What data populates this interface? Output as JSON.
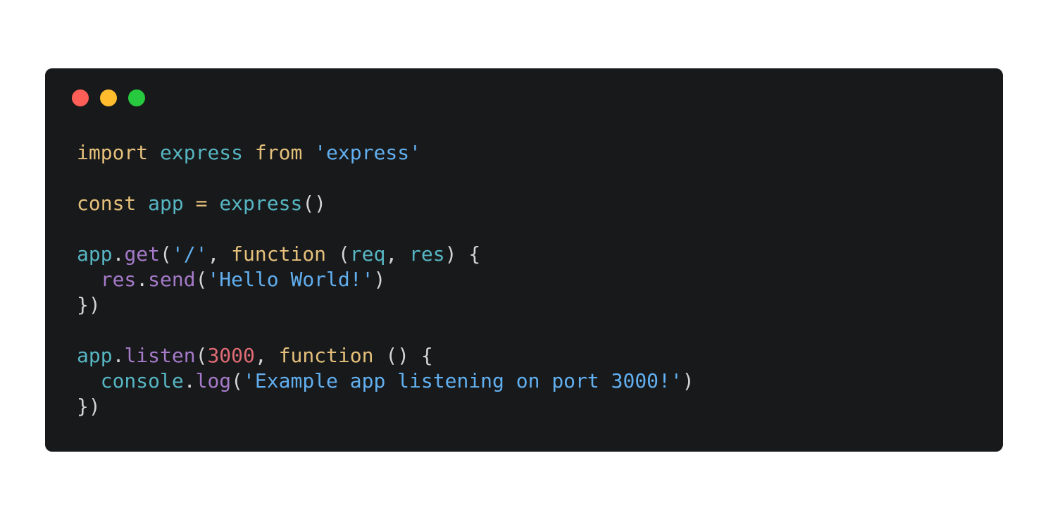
{
  "colors": {
    "page_bg": "#ffffff",
    "window_bg": "#18191b",
    "close": "#ff5f56",
    "minimize": "#ffbd2e",
    "maximize": "#27c93f",
    "keyword": "#e5c07b",
    "identifier": "#56b6c2",
    "method": "#a57ac9",
    "string": "#61afef",
    "number": "#e06c75",
    "punct": "#d4d4d4"
  },
  "window_controls": {
    "close_icon": "red-circle",
    "minimize_icon": "yellow-circle",
    "maximize_icon": "green-circle"
  },
  "code_lines": [
    [
      {
        "text": "import",
        "kind": "keyword"
      },
      {
        "text": " ",
        "kind": "punct"
      },
      {
        "text": "express",
        "kind": "identifier"
      },
      {
        "text": " ",
        "kind": "punct"
      },
      {
        "text": "from",
        "kind": "keyword"
      },
      {
        "text": " ",
        "kind": "punct"
      },
      {
        "text": "'express'",
        "kind": "string"
      }
    ],
    [],
    [
      {
        "text": "const",
        "kind": "keyword"
      },
      {
        "text": " ",
        "kind": "punct"
      },
      {
        "text": "app",
        "kind": "identifier"
      },
      {
        "text": " ",
        "kind": "punct"
      },
      {
        "text": "=",
        "kind": "keyword"
      },
      {
        "text": " ",
        "kind": "punct"
      },
      {
        "text": "express",
        "kind": "identifier"
      },
      {
        "text": "()",
        "kind": "punct"
      }
    ],
    [],
    [
      {
        "text": "app",
        "kind": "identifier"
      },
      {
        "text": ".",
        "kind": "punct"
      },
      {
        "text": "get",
        "kind": "method"
      },
      {
        "text": "(",
        "kind": "punct"
      },
      {
        "text": "'/'",
        "kind": "string"
      },
      {
        "text": ", ",
        "kind": "punct"
      },
      {
        "text": "function",
        "kind": "keyword"
      },
      {
        "text": " (",
        "kind": "punct"
      },
      {
        "text": "req",
        "kind": "identifier"
      },
      {
        "text": ", ",
        "kind": "punct"
      },
      {
        "text": "res",
        "kind": "identifier"
      },
      {
        "text": ") {",
        "kind": "punct"
      }
    ],
    [
      {
        "text": "  ",
        "kind": "punct"
      },
      {
        "text": "res",
        "kind": "method"
      },
      {
        "text": ".",
        "kind": "punct"
      },
      {
        "text": "send",
        "kind": "method"
      },
      {
        "text": "(",
        "kind": "punct"
      },
      {
        "text": "'Hello World!'",
        "kind": "string"
      },
      {
        "text": ")",
        "kind": "punct"
      }
    ],
    [
      {
        "text": "})",
        "kind": "punct"
      }
    ],
    [],
    [
      {
        "text": "app",
        "kind": "identifier"
      },
      {
        "text": ".",
        "kind": "punct"
      },
      {
        "text": "listen",
        "kind": "method"
      },
      {
        "text": "(",
        "kind": "punct"
      },
      {
        "text": "3000",
        "kind": "number"
      },
      {
        "text": ", ",
        "kind": "punct"
      },
      {
        "text": "function",
        "kind": "keyword"
      },
      {
        "text": " () {",
        "kind": "punct"
      }
    ],
    [
      {
        "text": "  ",
        "kind": "punct"
      },
      {
        "text": "console",
        "kind": "identifier"
      },
      {
        "text": ".",
        "kind": "punct"
      },
      {
        "text": "log",
        "kind": "method"
      },
      {
        "text": "(",
        "kind": "punct"
      },
      {
        "text": "'Example app listening on port 3000!'",
        "kind": "string"
      },
      {
        "text": ")",
        "kind": "punct"
      }
    ],
    [
      {
        "text": "})",
        "kind": "punct"
      }
    ]
  ]
}
